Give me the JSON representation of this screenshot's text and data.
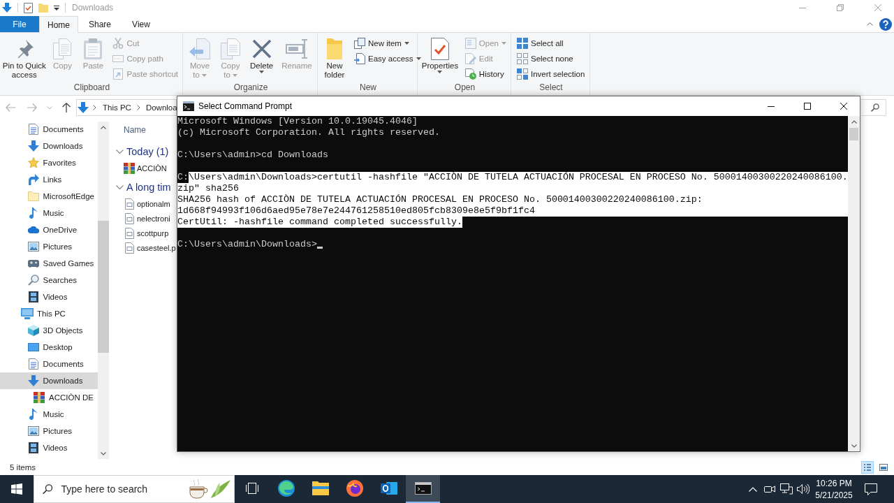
{
  "explorer": {
    "title": "Downloads",
    "tabs": [
      {
        "label": "File",
        "kind": "file",
        "selected": false
      },
      {
        "label": "Home",
        "kind": "tab",
        "selected": true
      },
      {
        "label": "Share",
        "kind": "tab",
        "selected": false
      },
      {
        "label": "View",
        "kind": "tab",
        "selected": false
      }
    ],
    "ribbon_groups": [
      {
        "label": "Clipboard",
        "large_buttons": [
          {
            "label_lines": [
              "Pin to Quick",
              "access"
            ],
            "kind": "pin",
            "disabled": false,
            "dropdown": false
          },
          {
            "label_lines": [
              "Copy"
            ],
            "kind": "copy",
            "disabled": true,
            "dropdown": false
          },
          {
            "label_lines": [
              "Paste"
            ],
            "kind": "paste",
            "disabled": true,
            "dropdown": false
          }
        ],
        "small_buttons": [
          {
            "label": "Cut",
            "kind": "cut",
            "disabled": true,
            "dropdown": false
          },
          {
            "label": "Copy path",
            "kind": "copypath",
            "disabled": true,
            "dropdown": false
          },
          {
            "label": "Paste shortcut",
            "kind": "pasteshortcut",
            "disabled": true,
            "dropdown": false
          }
        ]
      },
      {
        "label": "Organize",
        "large_buttons": [
          {
            "label_lines": [
              "Move",
              "to"
            ],
            "kind": "move",
            "disabled": true,
            "dropdown": true
          },
          {
            "label_lines": [
              "Copy",
              "to"
            ],
            "kind": "copyto",
            "disabled": true,
            "dropdown": true
          },
          {
            "label_lines": [
              "Delete"
            ],
            "kind": "delete",
            "disabled": false,
            "dropdown": true
          },
          {
            "label_lines": [
              "Rename"
            ],
            "kind": "rename",
            "disabled": true,
            "dropdown": false
          }
        ]
      },
      {
        "label": "New",
        "large_buttons": [
          {
            "label_lines": [
              "New",
              "folder"
            ],
            "kind": "newfolder",
            "disabled": false,
            "dropdown": false
          }
        ],
        "small_buttons": [
          {
            "label": "New item",
            "kind": "newitem",
            "disabled": false,
            "dropdown": true
          },
          {
            "label": "Easy access",
            "kind": "easyaccess",
            "disabled": false,
            "dropdown": true
          }
        ]
      },
      {
        "label": "Open",
        "large_buttons": [
          {
            "label_lines": [
              "Properties"
            ],
            "kind": "properties",
            "disabled": false,
            "dropdown": true
          }
        ],
        "small_buttons": [
          {
            "label": "Open",
            "kind": "open",
            "disabled": true,
            "dropdown": true
          },
          {
            "label": "Edit",
            "kind": "edit",
            "disabled": true,
            "dropdown": false
          },
          {
            "label": "History",
            "kind": "history",
            "disabled": false,
            "dropdown": false
          }
        ]
      },
      {
        "label": "Select",
        "small_buttons": [
          {
            "label": "Select all",
            "kind": "selectall",
            "disabled": false,
            "dropdown": false
          },
          {
            "label": "Select none",
            "kind": "selectnone",
            "disabled": false,
            "dropdown": false
          },
          {
            "label": "Invert selection",
            "kind": "invert",
            "disabled": false,
            "dropdown": false
          }
        ]
      }
    ],
    "address": {
      "path": [
        "This PC",
        "Downloa"
      ]
    },
    "navigation": {
      "continued_items": [
        {
          "label": "Documents",
          "kind": "documents",
          "selected": false
        },
        {
          "label": "Downloads",
          "kind": "downloads",
          "selected": false
        },
        {
          "label": "Favorites",
          "kind": "favorites",
          "selected": false
        },
        {
          "label": "Links",
          "kind": "links",
          "selected": false
        },
        {
          "label": "MicrosoftEdge",
          "kind": "folder",
          "selected": false
        },
        {
          "label": "Music",
          "kind": "music",
          "selected": false
        },
        {
          "label": "OneDrive",
          "kind": "onedrive",
          "selected": false
        },
        {
          "label": "Pictures",
          "kind": "pictures",
          "selected": false
        },
        {
          "label": "Saved Games",
          "kind": "savedgames",
          "selected": false
        },
        {
          "label": "Searches",
          "kind": "searches",
          "selected": false
        },
        {
          "label": "Videos",
          "kind": "videos",
          "selected": false
        }
      ],
      "items": [
        {
          "label": "This PC",
          "kind": "pc",
          "selected": false,
          "children": [
            {
              "label": "3D Objects",
              "kind": "objects3d",
              "selected": false
            },
            {
              "label": "Desktop",
              "kind": "desktop",
              "selected": false
            },
            {
              "label": "Documents",
              "kind": "documents",
              "selected": false
            },
            {
              "label": "Downloads",
              "kind": "downloads",
              "selected": true,
              "children": [
                {
                  "label": "ACCIÒN DE",
                  "kind": "archive",
                  "selected": false
                }
              ]
            },
            {
              "label": "Music",
              "kind": "music",
              "selected": false
            },
            {
              "label": "Pictures",
              "kind": "pictures",
              "selected": false
            },
            {
              "label": "Videos",
              "kind": "videos",
              "selected": false
            }
          ]
        }
      ]
    },
    "content": {
      "column": "Name",
      "groups": [
        {
          "title": "Today (1)",
          "expanded": true,
          "files": [
            {
              "name": "ACCIÒN",
              "kind": "archive"
            }
          ]
        },
        {
          "title": "A long tim",
          "expanded": true,
          "files": [
            {
              "name": "optionalm",
              "kind": "document"
            },
            {
              "name": "nelectroni",
              "kind": "document"
            },
            {
              "name": "scottpurp",
              "kind": "document"
            },
            {
              "name": "casesteel.p",
              "kind": "document"
            }
          ]
        }
      ]
    },
    "status": "5 items",
    "view_buttons": [
      {
        "kind": "details",
        "selected": true
      },
      {
        "kind": "large_icons",
        "selected": false
      }
    ]
  },
  "command_prompt": {
    "title": "Select Command Prompt",
    "lines": [
      {
        "kind": "text",
        "segments": [
          {
            "text": "Microsoft Windows [Version 10.0.19045.4046]",
            "selected": false
          }
        ],
        "cursor": false
      },
      {
        "kind": "text",
        "segments": [
          {
            "text": "(c) Microsoft Corporation. All rights reserved.",
            "selected": false
          }
        ],
        "cursor": false
      },
      {
        "kind": "blank"
      },
      {
        "kind": "text",
        "segments": [
          {
            "text": "C:\\Users\\admin>cd Downloads",
            "selected": false
          }
        ],
        "cursor": false
      },
      {
        "kind": "blank"
      },
      {
        "kind": "text",
        "segments": [
          {
            "text": "C:",
            "selected": false
          },
          {
            "text": "\\Users\\admin\\Downloads>certutil -hashfile \"ACCIÒN DE TUTELA ACTUACIÓN PROCESAL EN PROCESO No. 50001400300220240086100.",
            "selected": true
          }
        ],
        "cursor": false
      },
      {
        "kind": "text",
        "segments": [
          {
            "text": "zip\" sha256",
            "selected": true
          }
        ],
        "cursor": false
      },
      {
        "kind": "text",
        "segments": [
          {
            "text": "SHA256 hash of ACCIÒN DE TUTELA ACTUACIÓN PROCESAL EN PROCESO No. 50001400300220240086100.zip:",
            "selected": true
          }
        ],
        "cursor": false
      },
      {
        "kind": "text",
        "segments": [
          {
            "text": "1d668f94993f106d6aed95e78e7e244761258510ed805fcb8309e8e5f9bf1fc4",
            "selected": true
          }
        ],
        "cursor": false
      },
      {
        "kind": "text",
        "segments": [
          {
            "text": "CertUtil: -hashfile command completed successfully.",
            "selected": true
          }
        ],
        "cursor": false
      },
      {
        "kind": "blank"
      },
      {
        "kind": "text",
        "segments": [
          {
            "text": "C:\\Users\\admin\\Downloads>",
            "selected": false
          }
        ],
        "cursor": true
      }
    ]
  },
  "taskbar": {
    "search_placeholder": "Type here to search",
    "apps": [
      {
        "kind": "taskview",
        "selected": false
      },
      {
        "kind": "edge",
        "selected": false
      },
      {
        "kind": "explorer",
        "selected": false
      },
      {
        "kind": "firefox",
        "selected": false
      },
      {
        "kind": "outlook",
        "selected": false
      },
      {
        "kind": "terminal",
        "selected": true
      }
    ],
    "time": "10:26 PM",
    "date": "5/21/2025"
  }
}
